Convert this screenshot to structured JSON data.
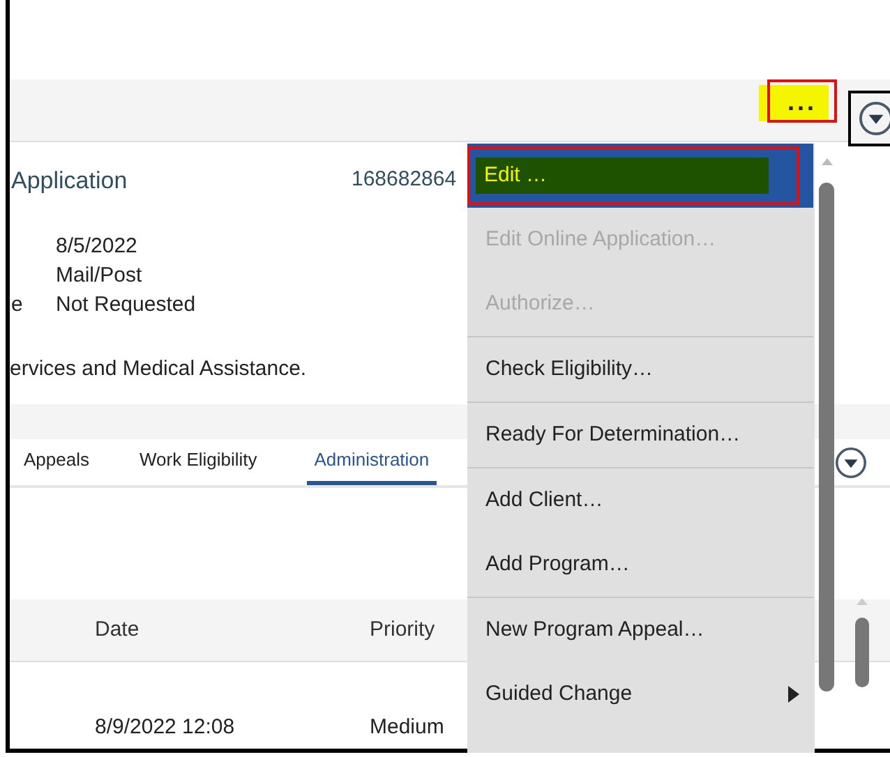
{
  "toolbar": {
    "more_button": "..."
  },
  "record": {
    "title": "Application",
    "reference": "168682864",
    "details": [
      {
        "value": "8/5/2022"
      },
      {
        "value": "Mail/Post"
      },
      {
        "label": "e",
        "value": "Not Requested"
      }
    ],
    "note": "ervices and Medical Assistance."
  },
  "tabs": [
    {
      "label": "Appeals",
      "selected": false
    },
    {
      "label": "Work Eligibility",
      "selected": false
    },
    {
      "label": "Administration",
      "selected": true
    }
  ],
  "table": {
    "columns": [
      "Date",
      "Priority"
    ],
    "rows": [
      [
        "8/9/2022 12:08",
        "Medium"
      ]
    ]
  },
  "menu": {
    "items": [
      {
        "label": "Edit …",
        "selected": true,
        "disabled": false,
        "submenu": false,
        "divider_after": false
      },
      {
        "label": "Edit Online Application…",
        "selected": false,
        "disabled": true,
        "submenu": false,
        "divider_after": false
      },
      {
        "label": "Authorize…",
        "selected": false,
        "disabled": true,
        "submenu": false,
        "divider_after": true
      },
      {
        "label": "Check Eligibility…",
        "selected": false,
        "disabled": false,
        "submenu": false,
        "divider_after": true
      },
      {
        "label": "Ready For Determination…",
        "selected": false,
        "disabled": false,
        "submenu": false,
        "divider_after": true
      },
      {
        "label": "Add Client…",
        "selected": false,
        "disabled": false,
        "submenu": false,
        "divider_after": false
      },
      {
        "label": "Add Program…",
        "selected": false,
        "disabled": false,
        "submenu": false,
        "divider_after": true
      },
      {
        "label": "New Program Appeal…",
        "selected": false,
        "disabled": false,
        "submenu": false,
        "divider_after": false
      },
      {
        "label": "Guided Change",
        "selected": false,
        "disabled": false,
        "submenu": true,
        "divider_after": false
      }
    ]
  }
}
